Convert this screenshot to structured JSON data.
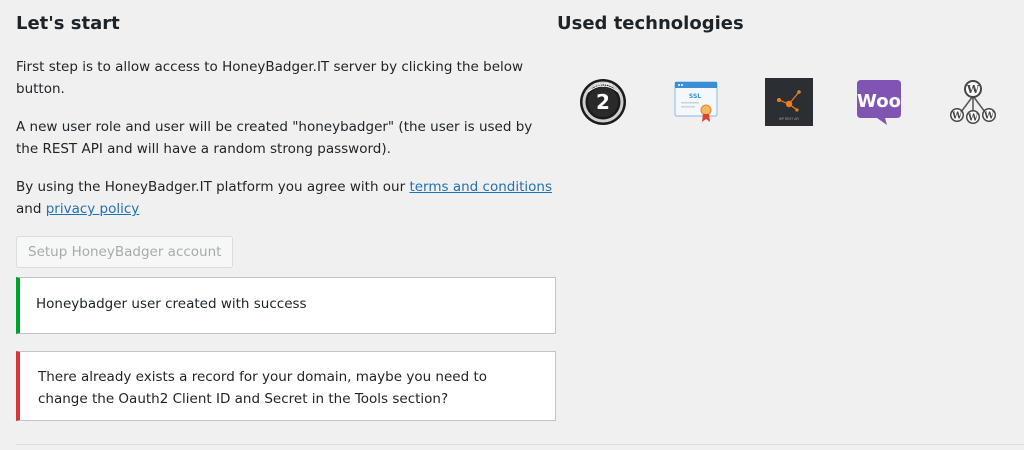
{
  "intro": {
    "title": "Let's start",
    "paragraph1": "First step is to allow access to HoneyBadger.IT server by clicking the below button.",
    "paragraph2": "A new user role and user will be created \"honeybadger\" (the user is used by the REST API and will have a random strong password).",
    "paragraph3_prefix": "By using the HoneyBadger.IT platform you agree with our ",
    "terms_link": "terms and conditions",
    "paragraph3_and": "and ",
    "privacy_link": "privacy policy",
    "setup_button": "Setup HoneyBadger account"
  },
  "notices": {
    "success": "Honeybadger user created with success",
    "error": "There already exists a record for your domain, maybe you need to change the Oauth2 Client ID and Secret in the Tools section?"
  },
  "technologies": {
    "title": "Used technologies",
    "items": [
      {
        "name": "oauth2-icon",
        "label": "2",
        "arc_text": "OAUTH"
      },
      {
        "name": "ssl-icon",
        "label": "SSL"
      },
      {
        "name": "wp-rest-api-icon",
        "label": "WP REST API"
      },
      {
        "name": "woocommerce-icon",
        "label": "Woo"
      },
      {
        "name": "wordpress-multisite-icon"
      }
    ],
    "colors": {
      "woo": "#7f54b3",
      "restbg": "#2b2f33",
      "rest_dot": "#f07f1a",
      "ssl_blue": "#3a8ed6"
    }
  },
  "colors": {
    "success": "#00a32a",
    "error": "#d63638",
    "link": "#2271b1"
  }
}
